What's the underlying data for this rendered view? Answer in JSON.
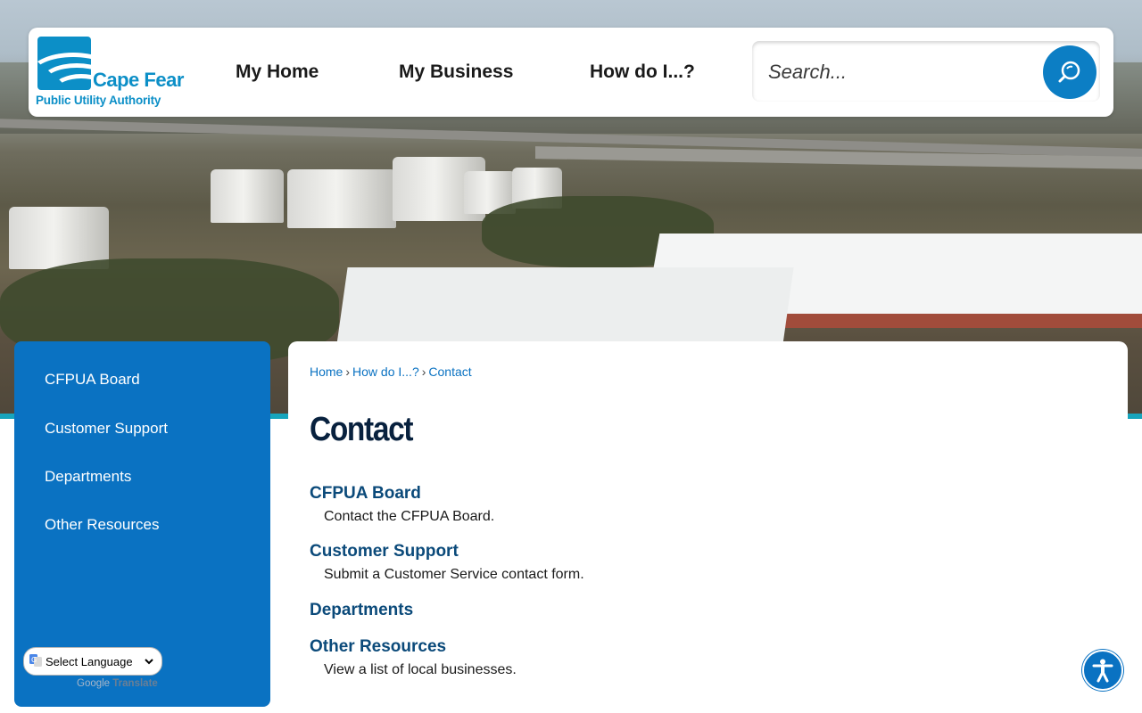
{
  "header": {
    "logo": {
      "name": "Cape Fear",
      "sub": "Public Utility Authority"
    },
    "nav": [
      {
        "label": "My Home"
      },
      {
        "label": "My Business"
      },
      {
        "label": "How do I...?"
      }
    ],
    "search": {
      "placeholder": "Search...",
      "button_icon": "search-icon"
    }
  },
  "sidebar": {
    "items": [
      {
        "label": "CFPUA Board"
      },
      {
        "label": "Customer Support"
      },
      {
        "label": "Departments"
      },
      {
        "label": "Other Resources"
      }
    ],
    "language": {
      "selected": "Select Language",
      "powered_by_prefix": "Google",
      "powered_by_suffix": "Translate"
    }
  },
  "breadcrumb": {
    "items": [
      "Home",
      "How do I...?",
      "Contact"
    ],
    "separator": "›"
  },
  "page": {
    "title": "Contact",
    "entries": [
      {
        "title": "CFPUA Board",
        "description": "Contact the CFPUA Board."
      },
      {
        "title": "Customer Support",
        "description": "Submit a Customer Service contact form."
      },
      {
        "title": "Departments",
        "description": ""
      },
      {
        "title": "Other Resources",
        "description": "View a list of local businesses."
      }
    ]
  },
  "colors": {
    "brand_blue": "#0a72c2",
    "logo_blue": "#0c8fc7",
    "teal_band": "#17a5bd",
    "title_navy": "#08213e",
    "link_navy": "#0b4a7a"
  },
  "accessibility": {
    "icon": "accessibility-icon"
  }
}
